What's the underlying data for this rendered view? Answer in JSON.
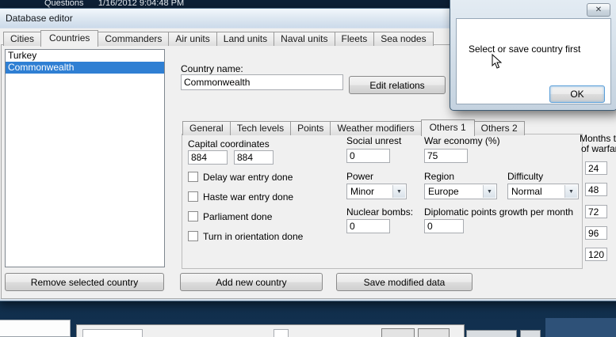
{
  "desktop": {
    "top_text": "Questions      1/16/2012 9:04:48 PM"
  },
  "editor": {
    "title": "Database editor",
    "tabs": [
      "Cities",
      "Countries",
      "Commanders",
      "Air units",
      "Land units",
      "Naval units",
      "Fleets",
      "Sea nodes"
    ],
    "active_tab": "Countries",
    "countries": [
      "Turkey",
      "Commonwealth"
    ],
    "selected_country": "Commonwealth",
    "country_name": {
      "label": "Country name:",
      "value": "Commonwealth"
    },
    "edit_relations": "Edit relations",
    "detail_tabs": [
      "General",
      "Tech levels",
      "Points",
      "Weather modifiers",
      "Others 1",
      "Others 2"
    ],
    "active_detail_tab": "Others 1",
    "others1": {
      "capital": {
        "label": "Capital coordinates",
        "x": "884",
        "y": "884"
      },
      "checkboxes": [
        "Delay war entry done",
        "Haste war entry done",
        "Parliament done",
        "Turn in orientation done"
      ],
      "social_unrest": {
        "label": "Social unrest",
        "value": "0"
      },
      "war_economy": {
        "label": "War economy (%)",
        "value": "75"
      },
      "power": {
        "label": "Power",
        "value": "Minor"
      },
      "region": {
        "label": "Region",
        "value": "Europe"
      },
      "difficulty": {
        "label": "Difficulty",
        "value": "Normal"
      },
      "nuclear_bombs": {
        "label": "Nuclear bombs:",
        "value": "0"
      },
      "diplomatic": {
        "label": "Diplomatic points growth per month",
        "value": "0"
      },
      "months": {
        "label_line1": "Months to",
        "label_line2": "of warfare",
        "values": [
          "24",
          "48",
          "72",
          "96",
          "120"
        ]
      }
    },
    "actions": {
      "remove": "Remove selected country",
      "add": "Add new country",
      "save": "Save modified data"
    }
  },
  "message_box": {
    "text": "Select or save country first",
    "ok": "OK",
    "close": "✕",
    "dropdown_arrow": "▼"
  }
}
